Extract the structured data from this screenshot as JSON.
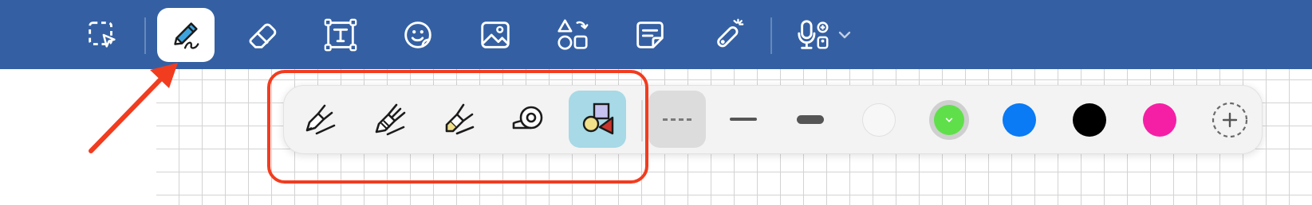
{
  "colors": {
    "toolbar_bg": "#3460a3",
    "toolbar_icon": "#ffffff",
    "annotation": "#f23c1f",
    "active_tool_bg": "#a7d9e6"
  },
  "toolbar": {
    "items": [
      {
        "icon": "lasso-select-icon",
        "selected": false
      },
      {
        "icon": "pen-icon",
        "selected": true
      },
      {
        "icon": "eraser-icon",
        "selected": false
      },
      {
        "icon": "text-box-icon",
        "selected": false
      },
      {
        "icon": "sticker-icon",
        "selected": false
      },
      {
        "icon": "image-icon",
        "selected": false
      },
      {
        "icon": "shapes-icon",
        "selected": false
      },
      {
        "icon": "sticky-note-icon",
        "selected": false
      },
      {
        "icon": "laser-pointer-icon",
        "selected": false
      },
      {
        "icon": "microphone-icon",
        "selected": false
      }
    ]
  },
  "palette": {
    "pen_tools": [
      {
        "icon": "fountain-pen-icon",
        "active": false
      },
      {
        "icon": "brush-pen-icon",
        "active": false
      },
      {
        "icon": "highlighter-icon",
        "active": false
      },
      {
        "icon": "tape-icon",
        "active": false
      },
      {
        "icon": "shape-pen-icon",
        "active": true
      }
    ],
    "stroke_styles": [
      {
        "icon": "dashed-stroke-icon",
        "active": true
      },
      {
        "icon": "thin-stroke-icon",
        "active": false
      },
      {
        "icon": "thick-stroke-icon",
        "active": false
      }
    ],
    "color_swatches": [
      {
        "name": "white",
        "color": "#f7f7f7",
        "selected": false
      },
      {
        "name": "green",
        "color": "#5fe04a",
        "selected": true
      },
      {
        "name": "blue",
        "color": "#0a7af5",
        "selected": false
      },
      {
        "name": "black",
        "color": "#000000",
        "selected": false
      },
      {
        "name": "pink",
        "color": "#f51fa6",
        "selected": false
      }
    ],
    "add_color_icon": "add-color-icon"
  }
}
